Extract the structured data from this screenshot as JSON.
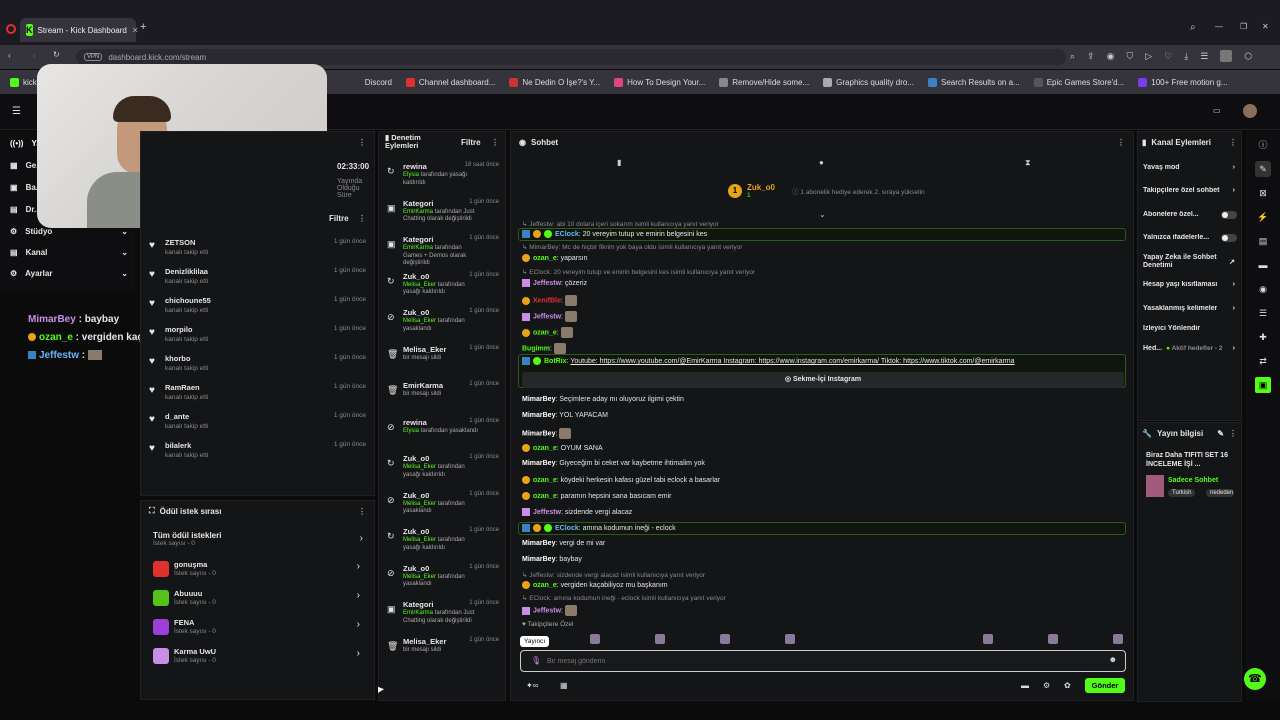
{
  "browser": {
    "tab_title": "Stream - Kick Dashboard",
    "url": "dashboard.kick.com/stream",
    "vpn": "VPN",
    "bookmarks": [
      "kick",
      "Discord",
      "Channel dashboard...",
      "Ne Dedin O İşe?'s Y...",
      "How To Design Your...",
      "Remove/Hide some...",
      "Graphics quality dro...",
      "Search Results on a...",
      "Epic Games Store'd...",
      "100+ Free motion g..."
    ]
  },
  "sidebar": {
    "items": [
      "Ya...",
      "Ge...",
      "Ba...",
      "Dr...",
      "Stüdyo",
      "Kanal",
      "Ayarlar"
    ]
  },
  "stream_info": {
    "time": "02:33:00",
    "status": "Yayında Olduğu Süre",
    "filter": "Filtre"
  },
  "overlay_chat": [
    {
      "user": "MimarBey",
      "text": "baybay"
    },
    {
      "user": "ozan_e",
      "text": "vergiden kaçabiliyoz mu başkanım"
    },
    {
      "user": "Jeffestw",
      "text": ""
    }
  ],
  "followers": [
    {
      "name": "ZETSON",
      "action": "kanalı takip etti",
      "time": "1 gün önce"
    },
    {
      "name": "Denizliklilaa",
      "action": "kanalı takip etti",
      "time": "1 gün önce"
    },
    {
      "name": "chichoune55",
      "action": "kanalı takip etti",
      "time": "1 gün önce"
    },
    {
      "name": "morpilo",
      "action": "kanalı takip etti",
      "time": "1 gün önce"
    },
    {
      "name": "khorbo",
      "action": "kanalı takip etti",
      "time": "1 gün önce"
    },
    {
      "name": "RamRaen",
      "action": "kanalı takip etti",
      "time": "1 gün önce"
    },
    {
      "name": "d_ante",
      "action": "kanalı takip etti",
      "time": "1 gün önce"
    },
    {
      "name": "bilalerk",
      "action": "kanalı takip etti",
      "time": "1 gün önce"
    }
  ],
  "rewards": {
    "title": "Ödül istek sırası",
    "all": "Tüm ödül istekleri",
    "all_sub": "İstek sayısı - 0",
    "items": [
      {
        "name": "gonuşma",
        "sub": "İstek sayısı - 0",
        "color": "#e03131"
      },
      {
        "name": "Abuuuu",
        "sub": "İstek sayısı - 0",
        "color": "#53c318"
      },
      {
        "name": "FENA",
        "sub": "İstek sayısı - 0",
        "color": "#9b3fd8"
      },
      {
        "name": "Karma UwU",
        "sub": "İstek sayısı - 0",
        "color": "#c98fe6"
      }
    ]
  },
  "mod": {
    "title": "Denetim Eylemleri",
    "filter": "Filtre",
    "actions": [
      {
        "name": "rewina",
        "who": "Elysia",
        "desc": "tarafından yasağı kaldırıldı",
        "time": "18 saat önce"
      },
      {
        "name": "Kategori",
        "who": "EmirKarma",
        "desc": "tarafından Just Chatting olarak değiştirildi",
        "time": "1 gün önce"
      },
      {
        "name": "Kategori",
        "who": "EmirKarma",
        "desc": "tarafından Games + Demos olarak değiştirildi",
        "time": "1 gün önce"
      },
      {
        "name": "Zuk_o0",
        "who": "Melisa_Eker",
        "desc": "tarafından yasağı kaldırıldı",
        "time": "1 gün önce"
      },
      {
        "name": "Zuk_o0",
        "who": "Melisa_Eker",
        "desc": "tarafından yasaklandı",
        "time": "1 gün önce"
      },
      {
        "name": "Melisa_Eker",
        "who": "",
        "desc": "bir mesajı sildi",
        "time": "1 gün önce"
      },
      {
        "name": "EmirKarma",
        "who": "",
        "desc": "bir mesajı sildi",
        "time": "1 gün önce"
      },
      {
        "name": "rewina",
        "who": "Elysia",
        "desc": "tarafından yasaklandı",
        "time": "1 gün önce"
      },
      {
        "name": "Zuk_o0",
        "who": "Melisa_Eker",
        "desc": "tarafından yasağı kaldırıldı",
        "time": "1 gün önce"
      },
      {
        "name": "Zuk_o0",
        "who": "Melisa_Eker",
        "desc": "tarafından yasaklandı",
        "time": "1 gün önce"
      },
      {
        "name": "Zuk_o0",
        "who": "Melisa_Eker",
        "desc": "tarafından yasağı kaldırıldı",
        "time": "1 gün önce"
      },
      {
        "name": "Zuk_o0",
        "who": "Melisa_Eker",
        "desc": "tarafından yasaklandı",
        "time": "1 gün önce"
      },
      {
        "name": "Kategori",
        "who": "EmirKarma",
        "desc": "tarafından Just Chatting olarak değiştirildi",
        "time": "1 gün önce"
      },
      {
        "name": "Melisa_Eker",
        "who": "",
        "desc": "bir mesajı sildi",
        "time": "1 gün önce"
      }
    ]
  },
  "chat": {
    "title": "Sohbet",
    "gift_user": "Zuk_o0",
    "gift_count": "1",
    "gift_text": "1 abonelik hediye ederek 2. sıraya yükselin",
    "button_ig": "Sekme-İçi Instagram",
    "followers_only": "Takipçilere Özel",
    "role": "Yayıncı",
    "placeholder": "Bir mesaj gönderin",
    "send": "Gönder",
    "lines": [
      {
        "kind": "reply",
        "text": "Jeffestw: abi 10 dolara içeri sokarım isimli kullanıcıya yanıt veriyor"
      },
      {
        "kind": "hl",
        "user": "EClock",
        "text": "20 vereyim tutup ve emirin belgesini kes"
      },
      {
        "kind": "reply",
        "text": "MimarBey: Mc de hiçbir fikrim yok baya oldu isimli kullanıcıya yanıt veriyor"
      },
      {
        "kind": "msg",
        "user": "ozan_e",
        "text": "yaparsın",
        "color": "#53fc18"
      },
      {
        "kind": "reply",
        "text": "EClock: 20 vereyim tutup ve emirin belgesini kes isimli kullanıcıya yanıt veriyor"
      },
      {
        "kind": "msg",
        "user": "Jeffestw",
        "text": "çözeriz",
        "color": "#c98fe6"
      },
      {
        "kind": "msg",
        "user": "XenifBle",
        "text": "",
        "color": "#e03131"
      },
      {
        "kind": "msg",
        "user": "Jeffestw",
        "text": "",
        "color": "#c98fe6"
      },
      {
        "kind": "msg",
        "user": "ozan_e",
        "text": "",
        "color": "#53fc18"
      },
      {
        "kind": "msg",
        "user": "Bugimm",
        "text": "",
        "color": "#53fc18"
      },
      {
        "kind": "bot",
        "user": "BotRix",
        "text": "Youtube: https://www.youtube.com/@EmirKarma Instagram: https://www.instagram.com/emirkarma/ Tiktok: https://www.tiktok.com/@emirkarma"
      },
      {
        "kind": "msg",
        "user": "MimarBey",
        "text": "Seçimlere aday mı oluyoruz ilgimi çektin",
        "color": "#fff"
      },
      {
        "kind": "msg",
        "user": "MimarBey",
        "text": "YOL YAPACAM",
        "color": "#fff"
      },
      {
        "kind": "msg",
        "user": "MimarBey",
        "text": "",
        "color": "#fff"
      },
      {
        "kind": "msg",
        "user": "ozan_e",
        "text": "OYUM SANA",
        "color": "#53fc18"
      },
      {
        "kind": "msg",
        "user": "MimarBey",
        "text": "Giyeceğim bi ceket var kaybetme ihtimalim yok",
        "color": "#fff"
      },
      {
        "kind": "msg",
        "user": "ozan_e",
        "text": "köydeki herkesin kafası güzel tabi eclock a basarlar",
        "color": "#53fc18"
      },
      {
        "kind": "msg",
        "user": "ozan_e",
        "text": "paramın hepsini sana basıcam emir",
        "color": "#53fc18"
      },
      {
        "kind": "msg",
        "user": "Jeffestw",
        "text": "sizdende vergi alacaz",
        "color": "#c98fe6"
      },
      {
        "kind": "hl",
        "user": "EClock",
        "text": "amına kodumun ineği - eclock"
      },
      {
        "kind": "msg",
        "user": "MimarBey",
        "text": "vergi de mi var",
        "color": "#fff"
      },
      {
        "kind": "msg",
        "user": "MimarBey",
        "text": "baybay",
        "color": "#fff"
      },
      {
        "kind": "reply",
        "text": "Jeffestw: sizdende vergi alacaz isimli kullanıcıya yanıt veriyor"
      },
      {
        "kind": "msg",
        "user": "ozan_e",
        "text": "vergiden kaçabiliyoz mu başkanım",
        "color": "#53fc18"
      },
      {
        "kind": "reply",
        "text": "EClock: amına kodumun ineği - eclock isimli kullanıcıya yanıt veriyor"
      },
      {
        "kind": "msg",
        "user": "Jeffestw",
        "text": "",
        "color": "#c98fe6"
      }
    ]
  },
  "channel_actions": {
    "title": "Kanal Eylemleri",
    "items": [
      "Yavaş mod",
      "Takipçilere özel sohbet",
      "Abonelere özel...",
      "Yalnızca ifadelerle...",
      "Yapay Zeka ile Sohbet Denetimi",
      "Hesap yaşı kısıtlaması",
      "Yasaklanmış kelimeler",
      "İzleyici Yönlendir",
      "Hed..."
    ],
    "aktif": "Aktif hedefler - 2"
  },
  "stream_meta": {
    "title": "Yayın bilgisi",
    "stream_title": "Biraz Daha TIFITI SET 16 İNCELEME İŞİ ...",
    "category": "Sadece Sohbet",
    "tags": [
      "Turkish",
      "nededen"
    ]
  }
}
